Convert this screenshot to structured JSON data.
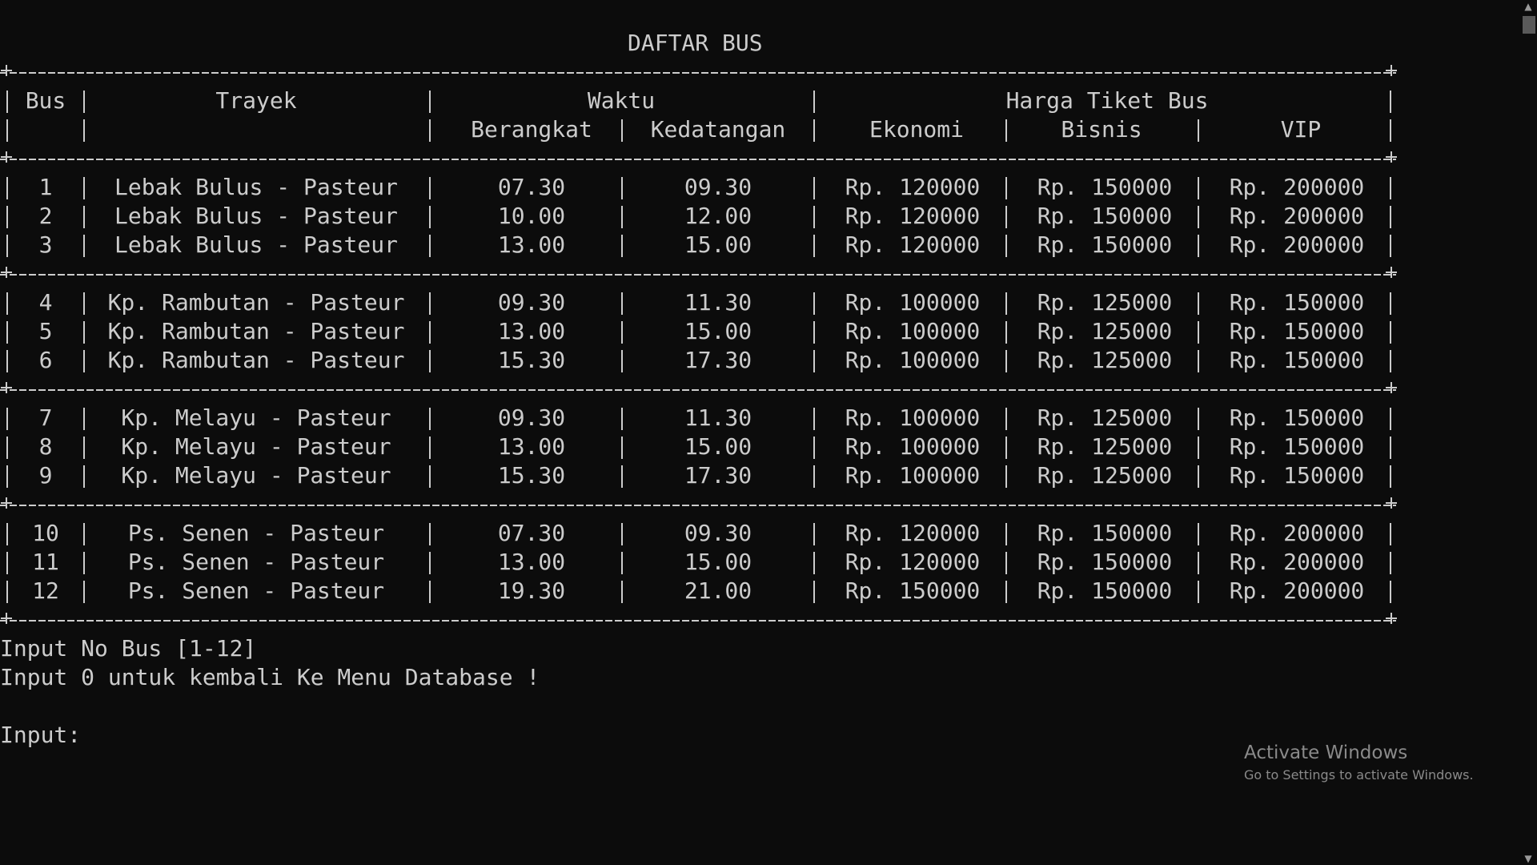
{
  "title": "DAFTAR BUS",
  "headers": {
    "bus": "Bus",
    "trayek": "Trayek",
    "waktu": "Waktu",
    "berangkat": "Berangkat",
    "kedatangan": "Kedatangan",
    "harga": "Harga Tiket Bus",
    "ekonomi": "Ekonomi",
    "bisnis": "Bisnis",
    "vip": "VIP"
  },
  "groups": [
    [
      {
        "no": "1",
        "trayek": "Lebak Bulus - Pasteur",
        "berangkat": "07.30",
        "kedatangan": "09.30",
        "ekonomi": "Rp. 120000",
        "bisnis": "Rp. 150000",
        "vip": "Rp. 200000"
      },
      {
        "no": "2",
        "trayek": "Lebak Bulus - Pasteur",
        "berangkat": "10.00",
        "kedatangan": "12.00",
        "ekonomi": "Rp. 120000",
        "bisnis": "Rp. 150000",
        "vip": "Rp. 200000"
      },
      {
        "no": "3",
        "trayek": "Lebak Bulus - Pasteur",
        "berangkat": "13.00",
        "kedatangan": "15.00",
        "ekonomi": "Rp. 120000",
        "bisnis": "Rp. 150000",
        "vip": "Rp. 200000"
      }
    ],
    [
      {
        "no": "4",
        "trayek": "Kp. Rambutan - Pasteur",
        "berangkat": "09.30",
        "kedatangan": "11.30",
        "ekonomi": "Rp. 100000",
        "bisnis": "Rp. 125000",
        "vip": "Rp. 150000"
      },
      {
        "no": "5",
        "trayek": "Kp. Rambutan - Pasteur",
        "berangkat": "13.00",
        "kedatangan": "15.00",
        "ekonomi": "Rp. 100000",
        "bisnis": "Rp. 125000",
        "vip": "Rp. 150000"
      },
      {
        "no": "6",
        "trayek": "Kp. Rambutan - Pasteur",
        "berangkat": "15.30",
        "kedatangan": "17.30",
        "ekonomi": "Rp. 100000",
        "bisnis": "Rp. 125000",
        "vip": "Rp. 150000"
      }
    ],
    [
      {
        "no": "7",
        "trayek": "Kp. Melayu - Pasteur",
        "berangkat": "09.30",
        "kedatangan": "11.30",
        "ekonomi": "Rp. 100000",
        "bisnis": "Rp. 125000",
        "vip": "Rp. 150000"
      },
      {
        "no": "8",
        "trayek": "Kp. Melayu - Pasteur",
        "berangkat": "13.00",
        "kedatangan": "15.00",
        "ekonomi": "Rp. 100000",
        "bisnis": "Rp. 125000",
        "vip": "Rp. 150000"
      },
      {
        "no": "9",
        "trayek": "Kp. Melayu - Pasteur",
        "berangkat": "15.30",
        "kedatangan": "17.30",
        "ekonomi": "Rp. 100000",
        "bisnis": "Rp. 125000",
        "vip": "Rp. 150000"
      }
    ],
    [
      {
        "no": "10",
        "trayek": "Ps. Senen - Pasteur",
        "berangkat": "07.30",
        "kedatangan": "09.30",
        "ekonomi": "Rp. 120000",
        "bisnis": "Rp. 150000",
        "vip": "Rp. 200000"
      },
      {
        "no": "11",
        "trayek": "Ps. Senen - Pasteur",
        "berangkat": "13.00",
        "kedatangan": "15.00",
        "ekonomi": "Rp. 120000",
        "bisnis": "Rp. 150000",
        "vip": "Rp. 200000"
      },
      {
        "no": "12",
        "trayek": "Ps. Senen - Pasteur",
        "berangkat": "19.30",
        "kedatangan": "21.00",
        "ekonomi": "Rp. 150000",
        "bisnis": "Rp. 150000",
        "vip": "Rp. 200000"
      }
    ]
  ],
  "prompt_lines": [
    "Input No Bus [1-12]",
    "Input 0 untuk kembali Ke Menu Database !"
  ],
  "input_prompt": "Input:",
  "watermark": {
    "title": "Activate Windows",
    "subtitle": "Go to Settings to activate Windows."
  },
  "scrollbar": {
    "up_icon": "▲",
    "down_icon": "▼"
  }
}
